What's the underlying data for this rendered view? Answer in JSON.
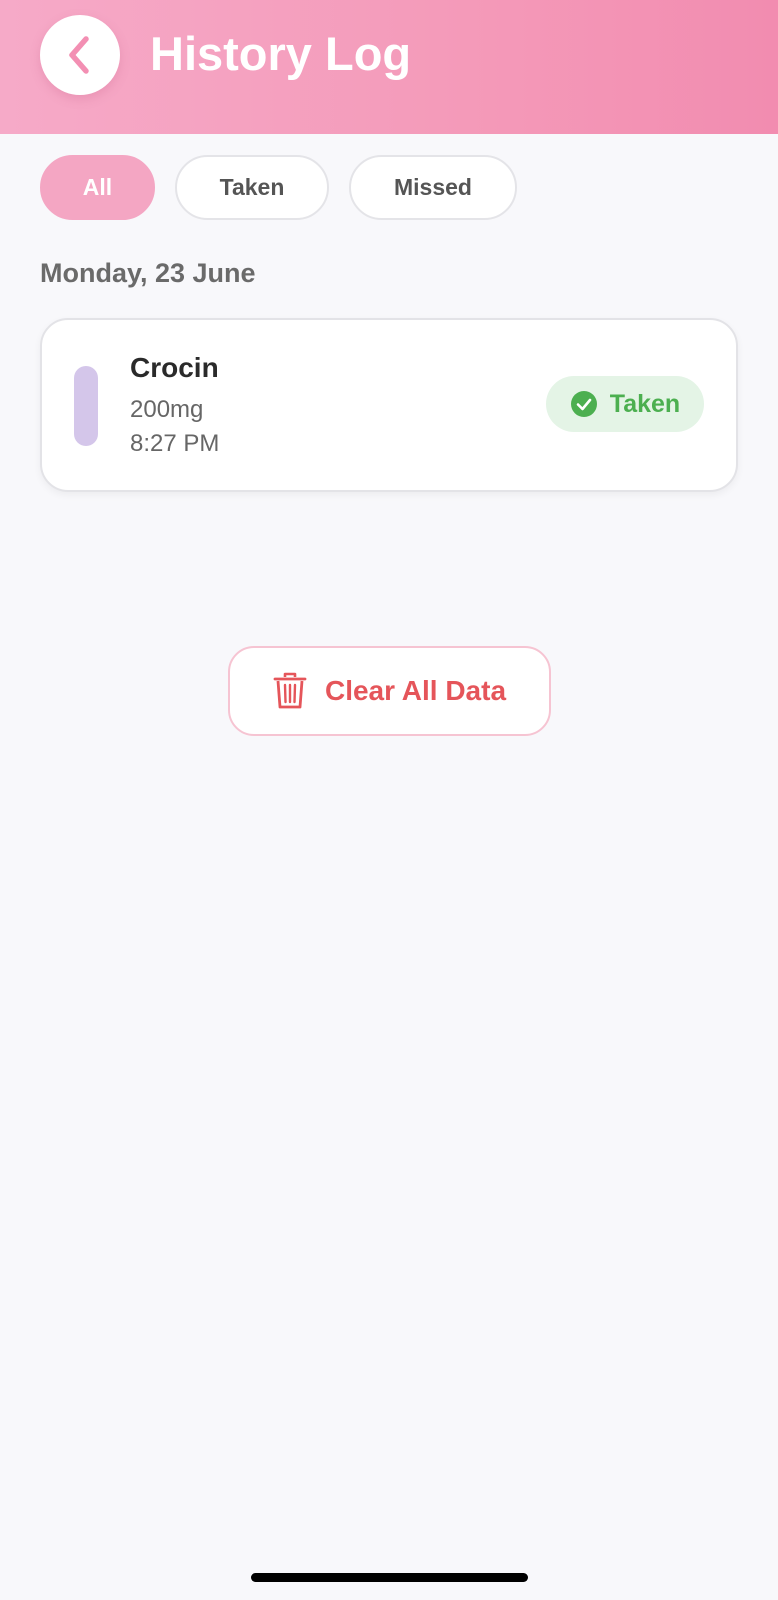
{
  "header": {
    "title": "History Log",
    "back_icon": "chevron-left-icon"
  },
  "filters": {
    "all": "All",
    "taken": "Taken",
    "missed": "Missed",
    "selected": "All"
  },
  "log": {
    "date_heading": "Monday, 23 June",
    "entries": [
      {
        "name": "Crocin",
        "dose": "200mg",
        "time": "8:27 PM",
        "status": "Taken",
        "status_icon": "check-circle-icon",
        "pill_color": "#d4c6ea"
      }
    ]
  },
  "actions": {
    "clear_label": "Clear All Data",
    "clear_icon": "trash-icon"
  },
  "colors": {
    "accent": "#f4a6c3",
    "success": "#4caf50",
    "danger": "#e5555a"
  }
}
